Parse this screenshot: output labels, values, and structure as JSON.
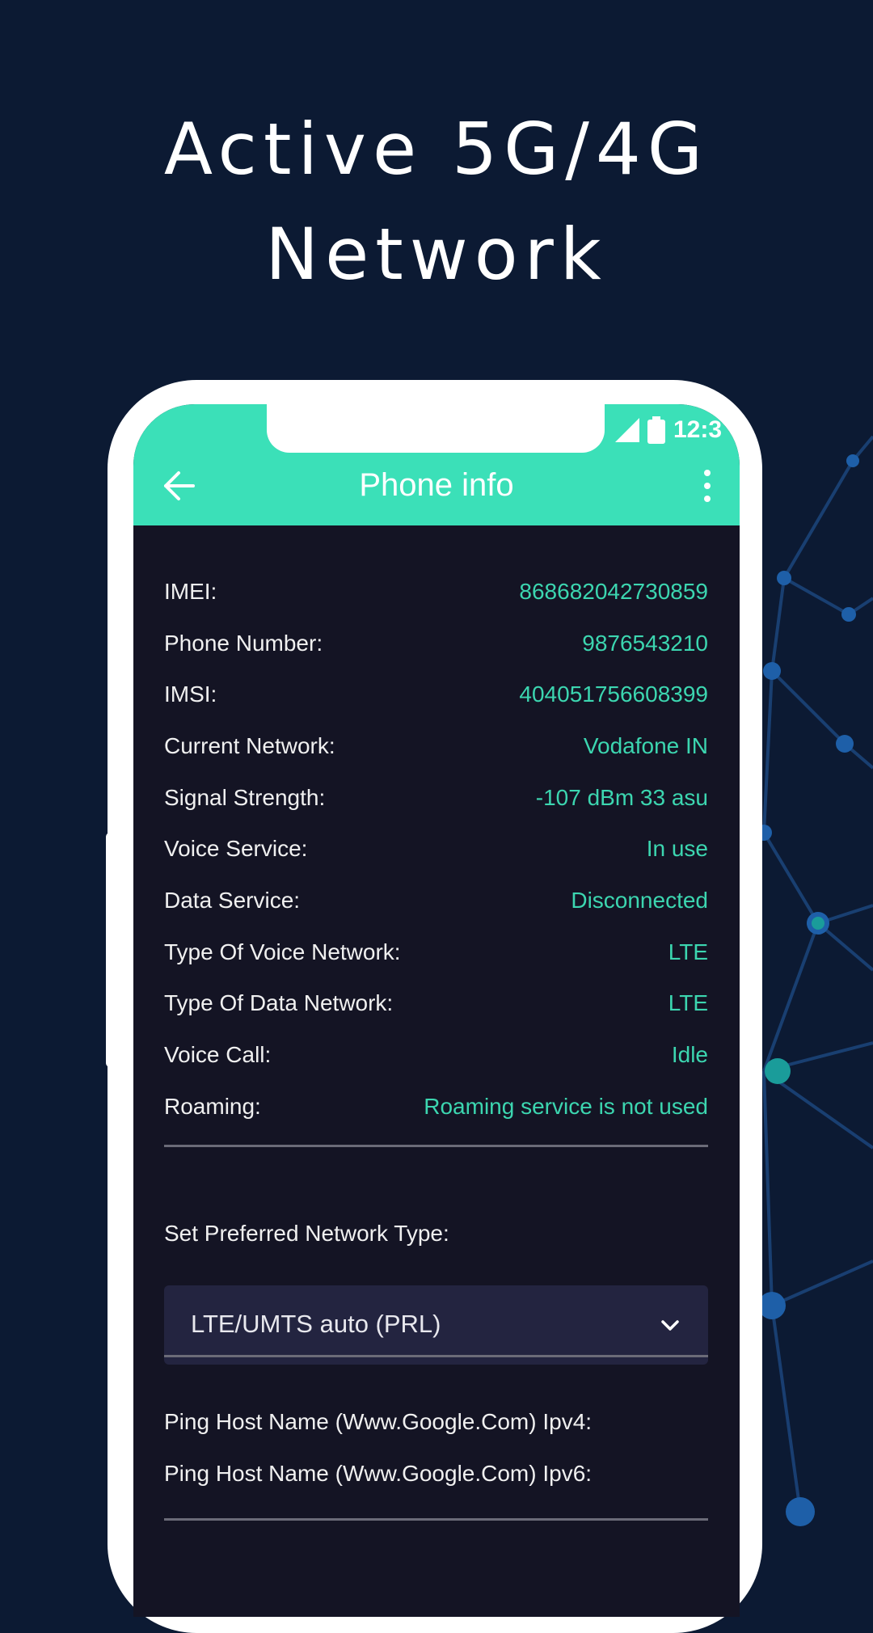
{
  "headline": {
    "line1": "Active 5G/4G",
    "line2": "Network"
  },
  "status_bar": {
    "time": "12:3"
  },
  "app_bar": {
    "title": "Phone info",
    "back_icon": "arrow-left-icon",
    "menu_icon": "more-vertical-icon"
  },
  "info_rows": [
    {
      "label": "IMEI:",
      "value": "868682042730859"
    },
    {
      "label": "Phone Number:",
      "value": "9876543210"
    },
    {
      "label": "IMSI:",
      "value": "404051756608399"
    },
    {
      "label": "Current Network:",
      "value": "Vodafone IN"
    },
    {
      "label": "Signal Strength:",
      "value": "-107 dBm 33 asu"
    },
    {
      "label": "Voice Service:",
      "value": "In use"
    },
    {
      "label": "Data Service:",
      "value": "Disconnected"
    },
    {
      "label": "Type Of Voice Network:",
      "value": "LTE"
    },
    {
      "label": "Type Of Data Network:",
      "value": "LTE"
    },
    {
      "label": "Voice Call:",
      "value": "Idle"
    },
    {
      "label": "Roaming:",
      "value": "Roaming service is not used"
    }
  ],
  "preferred_network": {
    "label": "Set Preferred Network Type:",
    "selected": "LTE/UMTS auto (PRL)",
    "chevron_icon": "chevron-down-icon"
  },
  "ping": {
    "ipv4": "Ping Host Name (Www.Google.Com) Ipv4:",
    "ipv6": "Ping Host Name (Www.Google.Com) Ipv6:"
  },
  "colors": {
    "background": "#0c1a33",
    "accent": "#3be0b8",
    "value_text": "#3cd6b0",
    "screen_bg": "#141424",
    "dropdown_bg": "#232440"
  }
}
